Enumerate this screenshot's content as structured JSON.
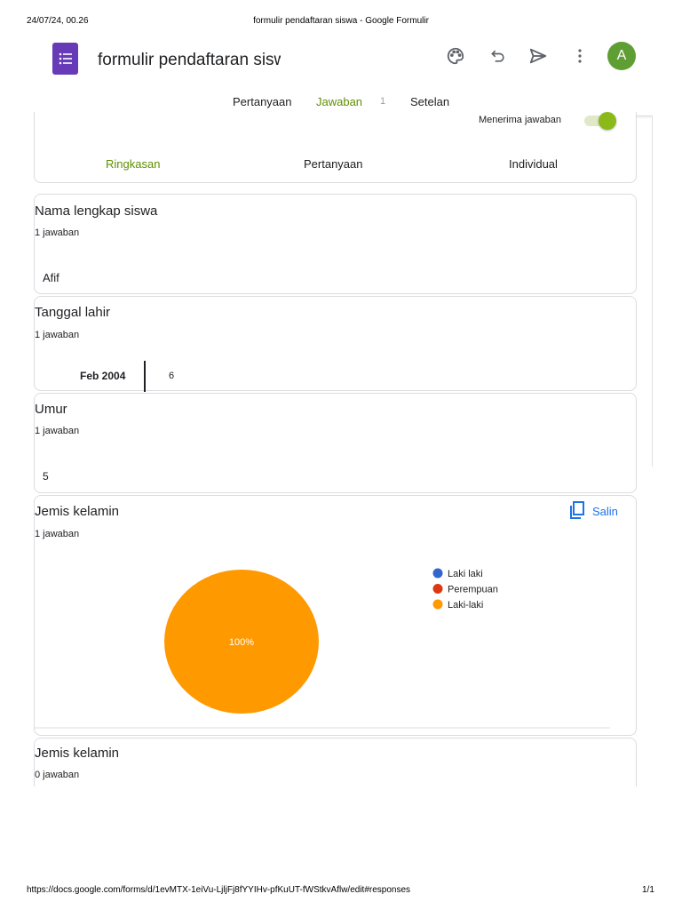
{
  "print_header": {
    "datetime": "24/07/24, 00.26",
    "title": "formulir pendaftaran siswa - Google Formulir"
  },
  "print_footer": {
    "url": "https://docs.google.com/forms/d/1evMTX-1eiVu-LjljFj8fYYIHv-pfKuUT-fWStkvAflw/edit#responses",
    "page": "1/1"
  },
  "app": {
    "form_title": "formulir pendaftaran siswa",
    "avatar_letter": "A",
    "accent": "#7cb342",
    "brand": "#673ab7"
  },
  "tabs": [
    {
      "label": "Pertanyaan"
    },
    {
      "label": "Jawaban",
      "count": "1"
    },
    {
      "label": "Setelan"
    }
  ],
  "responses": {
    "accepting_label": "Menerima jawaban",
    "accepting": true,
    "subtabs": [
      "Ringkasan",
      "Pertanyaan",
      "Individual"
    ]
  },
  "questions": [
    {
      "title": "Nama lengkap siswa",
      "count": "1 jawaban",
      "answer": "Afif"
    },
    {
      "title": "Tanggal lahir",
      "count": "1 jawaban",
      "month": "Feb 2004",
      "day": "6"
    },
    {
      "title": "Umur",
      "count": "1 jawaban",
      "answer": "5"
    },
    {
      "title": "Jemis kelamin",
      "count": "1 jawaban",
      "copy_label": "Salin"
    },
    {
      "title": "Jemis kelamin",
      "count": "0 jawaban"
    }
  ],
  "chart_data": {
    "type": "pie",
    "categories": [
      "Laki laki",
      "Perempuan",
      "Laki-laki"
    ],
    "values": [
      0,
      0,
      100
    ],
    "colors": [
      "#3366cc",
      "#dc3912",
      "#ff9900"
    ],
    "data_labels": [
      "",
      "",
      "100%"
    ],
    "legend": "right"
  }
}
